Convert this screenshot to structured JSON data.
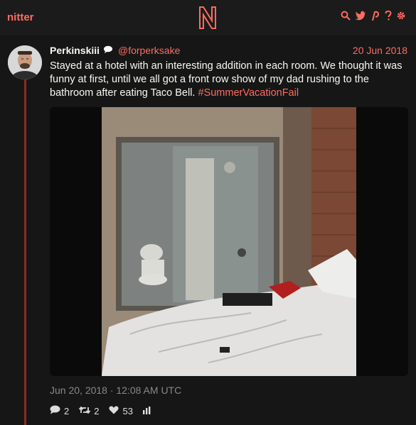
{
  "nav": {
    "brand": "nitter",
    "logo_letter": "N",
    "icons": [
      "search-icon",
      "twitter-icon",
      "rss-icon",
      "help-icon",
      "settings-icon"
    ],
    "accent_color": "#ff6c60"
  },
  "tweet": {
    "fullname": "Perkinskiii",
    "username": "@forperksake",
    "date": "20 Jun 2018",
    "text": "Stayed at a hotel with an interesting addition in each room. We thought it was funny at first, until we all got a front row show of my dad rushing to the bathroom after eating Taco Bell. ",
    "hashtag": "#SummerVacationFail",
    "published": "Jun 20, 2018 · 12:08 AM UTC",
    "stats": {
      "replies": "2",
      "retweets": "2",
      "likes": "53"
    }
  }
}
